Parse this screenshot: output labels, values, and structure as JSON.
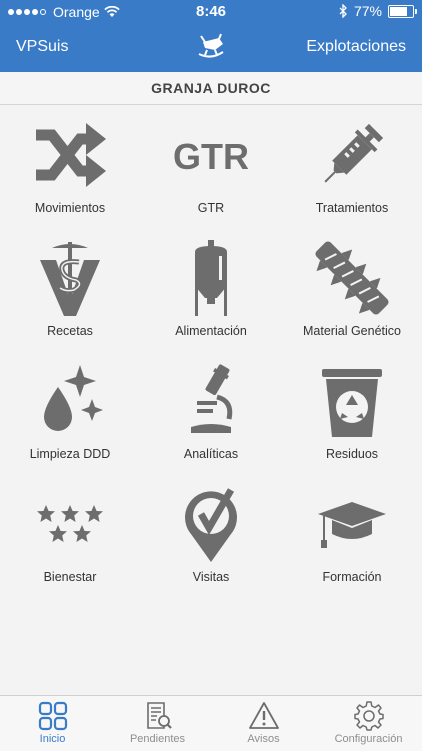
{
  "status_bar": {
    "carrier": "Orange",
    "time": "8:46",
    "battery": "77%",
    "battery_level": 0.77
  },
  "navbar": {
    "left": "VPSuis",
    "right": "Explotaciones",
    "logo_icon": "pig-logo-icon"
  },
  "farm_title": "GRANJA DUROC",
  "tiles": [
    {
      "label": "Movimientos",
      "icon": "shuffle-icon"
    },
    {
      "label": "GTR",
      "icon": "gtr-icon"
    },
    {
      "label": "Tratamientos",
      "icon": "syringe-icon"
    },
    {
      "label": "Recetas",
      "icon": "veterinary-caduceus-icon"
    },
    {
      "label": "Alimentación",
      "icon": "feed-silo-icon"
    },
    {
      "label": "Material Genético",
      "icon": "dna-icon"
    },
    {
      "label": "Limpieza DDD",
      "icon": "drop-sparkle-icon"
    },
    {
      "label": "Analíticas",
      "icon": "microscope-icon"
    },
    {
      "label": "Residuos",
      "icon": "recycle-bin-icon"
    },
    {
      "label": "Bienestar",
      "icon": "stars-icon"
    },
    {
      "label": "Visitas",
      "icon": "location-check-icon"
    },
    {
      "label": "Formación",
      "icon": "graduation-cap-icon"
    }
  ],
  "tabbar": [
    {
      "label": "Inicio",
      "icon": "grid-icon",
      "active": true
    },
    {
      "label": "Pendientes",
      "icon": "document-search-icon",
      "active": false
    },
    {
      "label": "Avisos",
      "icon": "warning-icon",
      "active": false
    },
    {
      "label": "Configuración",
      "icon": "gear-icon",
      "active": false
    }
  ],
  "colors": {
    "primary": "#3a7bc8",
    "icon_gray": "#6d6d6d",
    "background": "#f3f3f3",
    "tab_inactive": "#8e8e8e"
  }
}
